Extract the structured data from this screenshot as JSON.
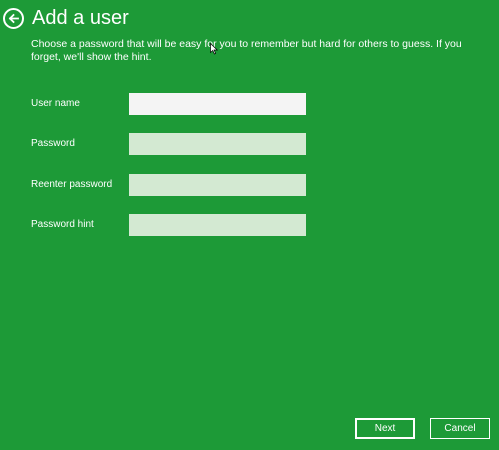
{
  "header": {
    "title": "Add a user",
    "description": "Choose a password that will be easy for you to remember but hard for others to guess. If you forget, we'll show the hint."
  },
  "form": {
    "fields": [
      {
        "label": "User name",
        "value": "",
        "state": "active"
      },
      {
        "label": "Password",
        "value": "",
        "state": "inactive"
      },
      {
        "label": "Reenter password",
        "value": "",
        "state": "inactive"
      },
      {
        "label": "Password hint",
        "value": "",
        "state": "inactive"
      }
    ]
  },
  "actions": {
    "next_label": "Next",
    "cancel_label": "Cancel"
  },
  "icons": {
    "back": "back-arrow-icon",
    "cursor": "mouse-pointer-icon"
  },
  "colors": {
    "background": "#1d9a37",
    "text": "#ffffff",
    "input_active": "#f4f4f4",
    "input_inactive": "#d3e9d2"
  }
}
